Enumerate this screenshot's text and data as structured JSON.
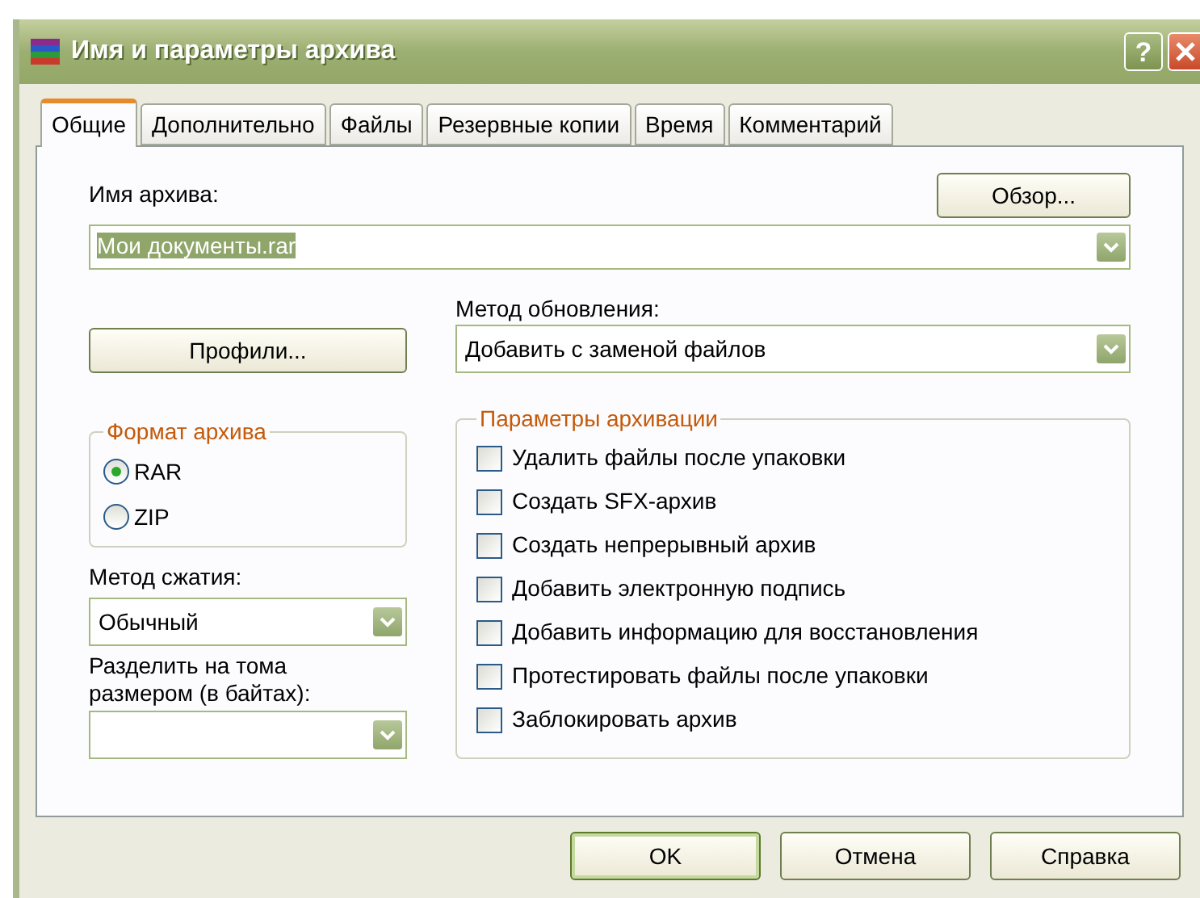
{
  "window": {
    "title": "Имя и параметры архива",
    "help_button": "?"
  },
  "tabs": [
    {
      "label": "Общие",
      "selected": true
    },
    {
      "label": "Дополнительно",
      "selected": false
    },
    {
      "label": "Файлы",
      "selected": false
    },
    {
      "label": "Резервные копии",
      "selected": false
    },
    {
      "label": "Время",
      "selected": false
    },
    {
      "label": "Комментарий",
      "selected": false
    }
  ],
  "archive_name": {
    "label": "Имя архива:",
    "browse_button": "Обзор...",
    "value": "Мои документы.rar"
  },
  "profiles_button": "Профили...",
  "update_method": {
    "label": "Метод обновления:",
    "value": "Добавить с заменой файлов"
  },
  "archive_format": {
    "title": "Формат архива",
    "options": [
      {
        "label": "RAR",
        "selected": true
      },
      {
        "label": "ZIP",
        "selected": false
      }
    ]
  },
  "compression_method": {
    "label": "Метод сжатия:",
    "value": "Обычный"
  },
  "split_volumes": {
    "label": "Разделить на тома размером (в байтах):"
  },
  "archive_options": {
    "title": "Параметры архивации",
    "items": [
      {
        "label": "Удалить файлы после упаковки",
        "checked": false
      },
      {
        "label": "Создать SFX-архив",
        "checked": false
      },
      {
        "label": "Создать непрерывный архив",
        "checked": false
      },
      {
        "label": "Добавить электронную подпись",
        "checked": false
      },
      {
        "label": "Добавить информацию для восстановления",
        "checked": false
      },
      {
        "label": "Протестировать файлы после упаковки",
        "checked": false
      },
      {
        "label": "Заблокировать архив",
        "checked": false
      }
    ]
  },
  "buttons": [
    {
      "label": "OK",
      "default": true
    },
    {
      "label": "Отмена",
      "default": false
    },
    {
      "label": "Справка",
      "default": false
    }
  ]
}
